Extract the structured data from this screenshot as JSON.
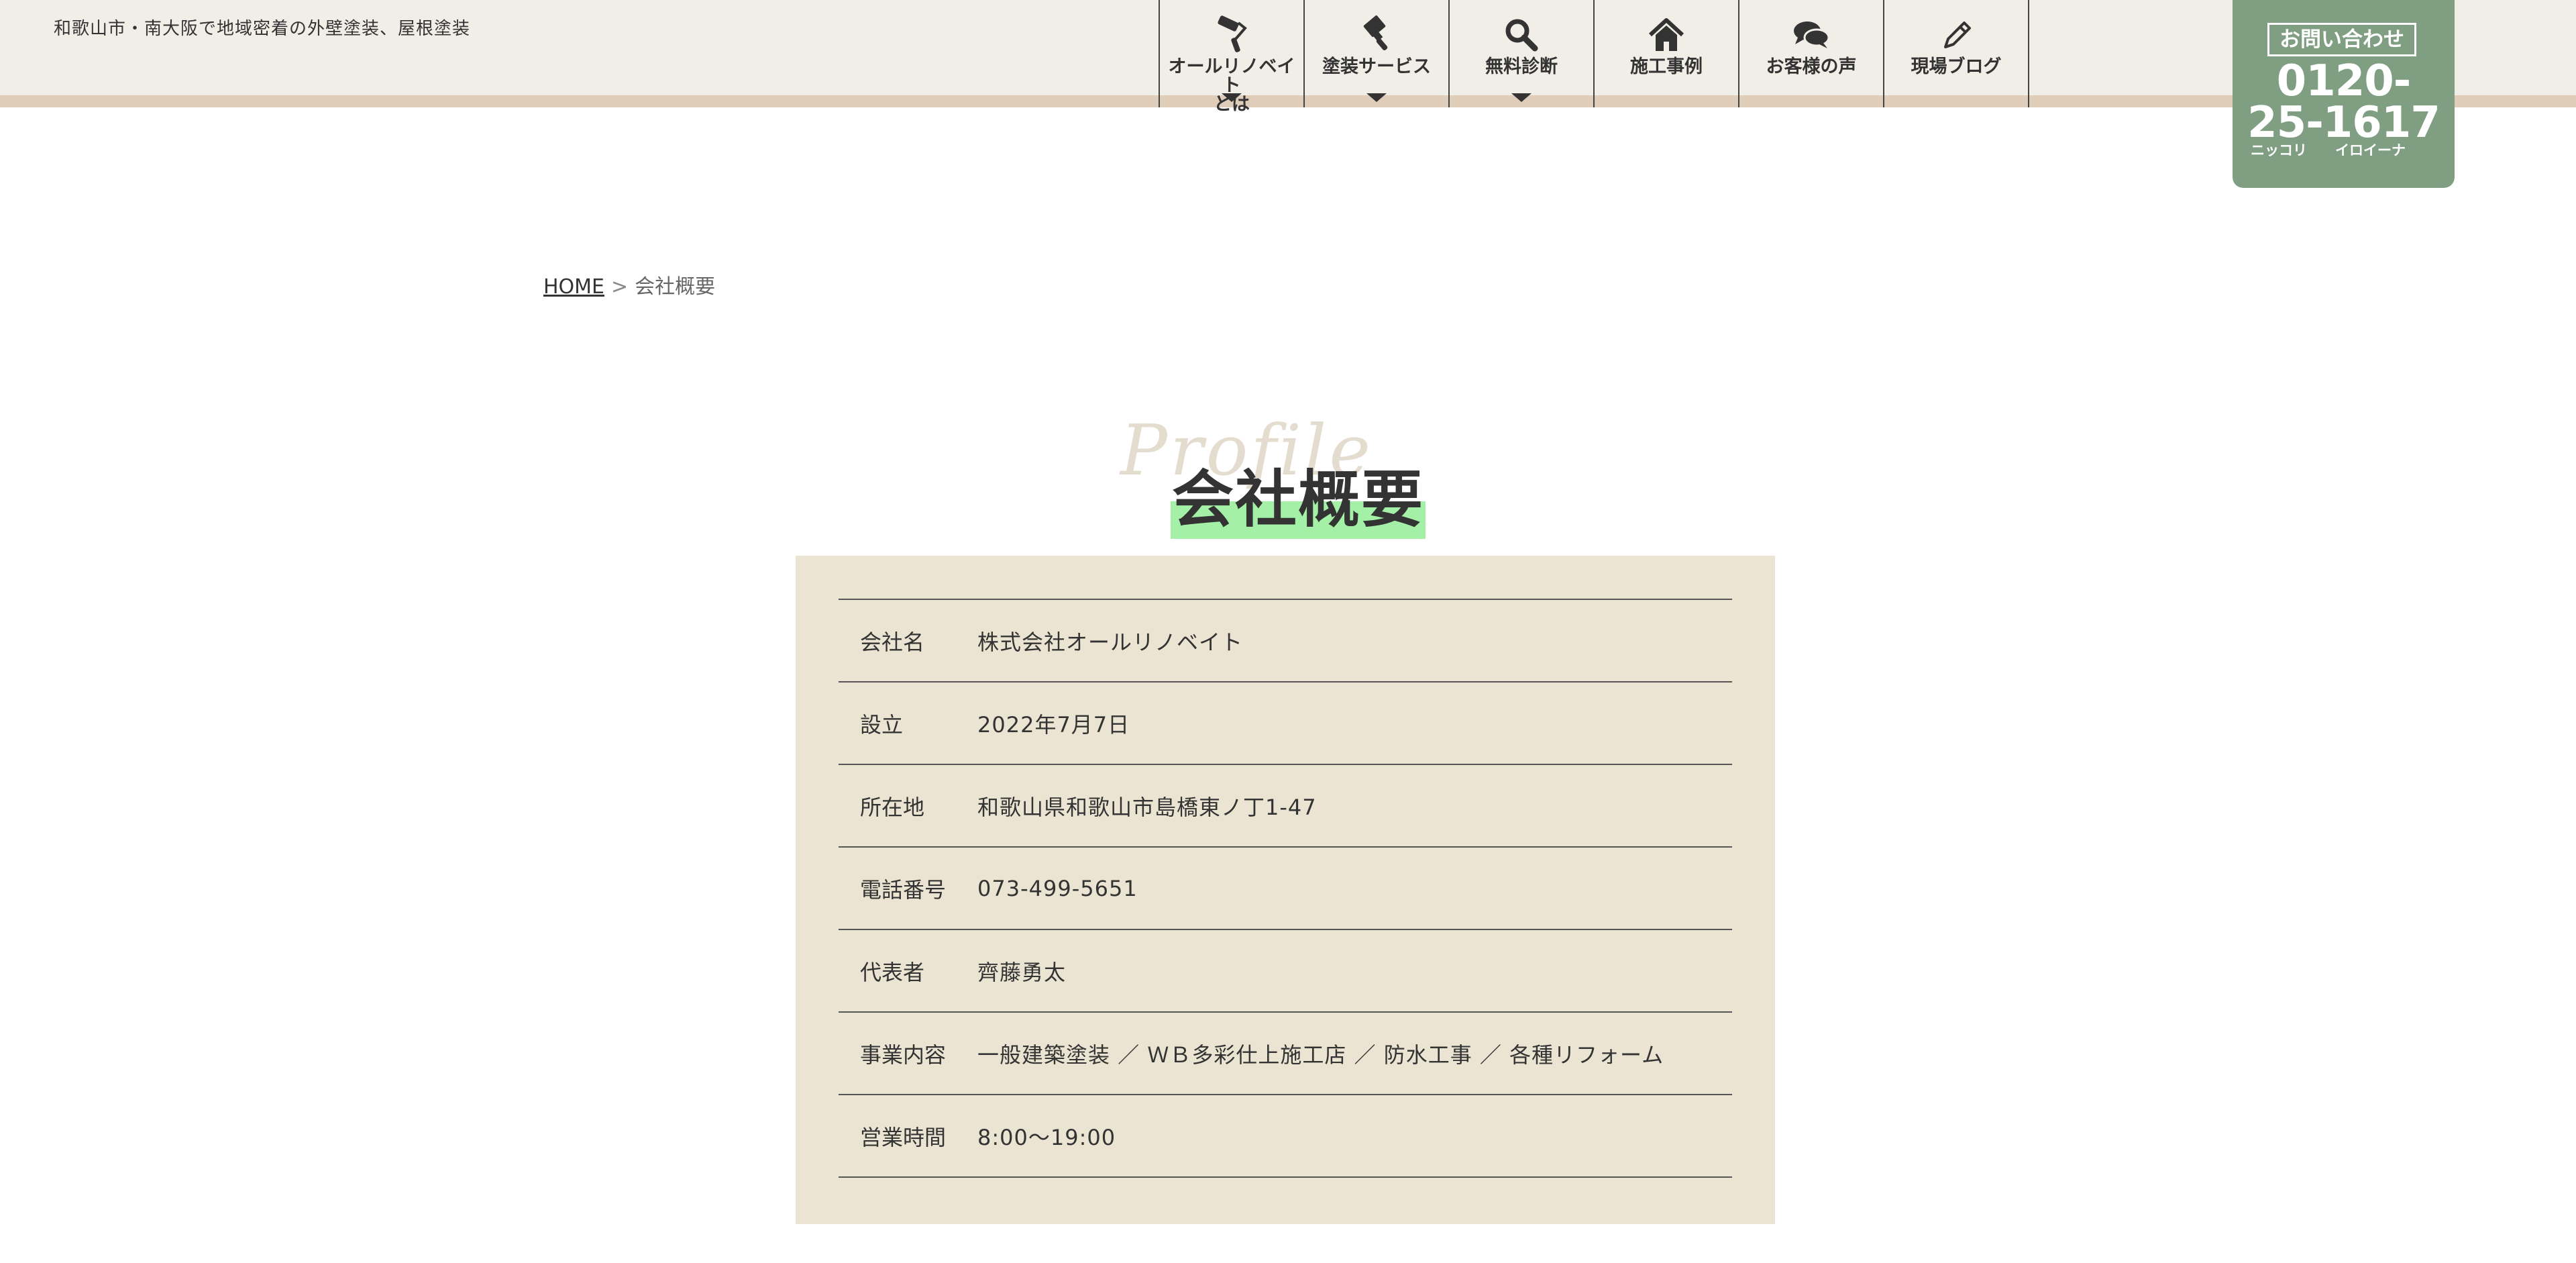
{
  "header": {
    "tagline": "和歌山市・南大阪で地域密着の外壁塗装、屋根塗装",
    "nav": [
      {
        "label": "オールリノベイト\nとは",
        "icon": "paint-roller-icon",
        "has_dropdown": true
      },
      {
        "label": "塗装サービス",
        "icon": "paint-brush-icon",
        "has_dropdown": true
      },
      {
        "label": "無料診断",
        "icon": "search-icon",
        "has_dropdown": true
      },
      {
        "label": "施工事例",
        "icon": "home-icon",
        "has_dropdown": false
      },
      {
        "label": "お客様の声",
        "icon": "chat-bubbles-icon",
        "has_dropdown": false
      },
      {
        "label": "現場ブログ",
        "icon": "pencil-icon",
        "has_dropdown": false
      }
    ],
    "contact": {
      "title": "お問い合わせ",
      "number_line1": "0120-",
      "number_line2": "25-1617",
      "kana_left": "ニッコリ",
      "kana_right": "イロイーナ"
    }
  },
  "breadcrumb": {
    "home": "HOME",
    "separator": ">",
    "current": "会社概要"
  },
  "page_title": {
    "script": "Profile",
    "main": "会社概要"
  },
  "profile": {
    "rows": [
      {
        "label": "会社名",
        "value": "株式会社オールリノベイト"
      },
      {
        "label": "設立",
        "value": "2022年7月7日"
      },
      {
        "label": "所在地",
        "value": "和歌山県和歌山市島橋東ノ丁1-47"
      },
      {
        "label": "電話番号",
        "value": "073-499-5651"
      },
      {
        "label": "代表者",
        "value": "齊藤勇太"
      },
      {
        "label": "事業内容",
        "value": "一般建築塗装 ／ ＷＢ多彩仕上施工店 ／ 防水工事 ／ 各種リフォーム"
      },
      {
        "label": "営業時間",
        "value": "8:00〜19:00"
      }
    ]
  },
  "colors": {
    "header_bg": "#f1eee8",
    "header_stripe": "#e0cdb9",
    "contact_bg": "#7f9e82",
    "profile_bg": "#ebe4d2",
    "title_highlight": "#a3f0a6"
  }
}
